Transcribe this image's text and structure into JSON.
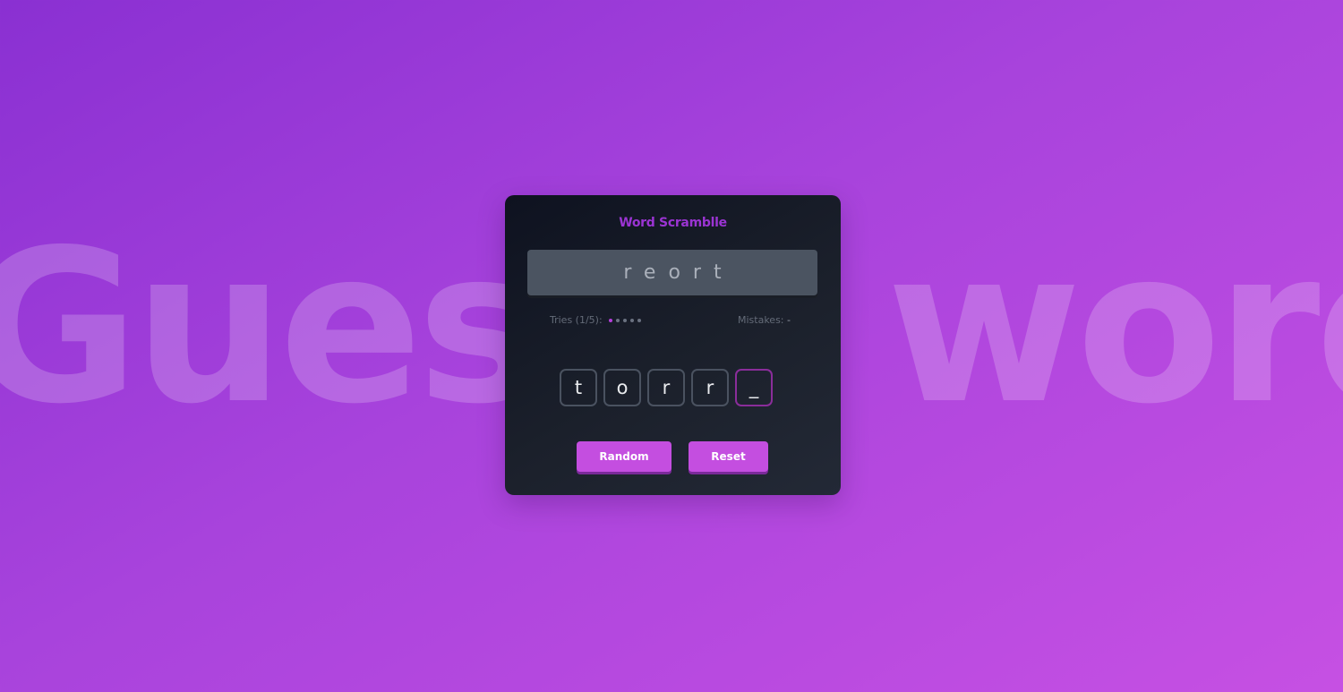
{
  "background": {
    "left_word": "Guess",
    "right_word": "word"
  },
  "card": {
    "title": "Word Scramblle",
    "scrambled_word": "reort",
    "tries_label": "Tries (1/5):",
    "tries_used": 1,
    "tries_total": 5,
    "mistakes_label": "Mistakes:",
    "mistakes_value": "-",
    "letters": [
      "t",
      "o",
      "r",
      "r",
      "_"
    ],
    "random_label": "Random",
    "reset_label": "Reset"
  },
  "colors": {
    "accent": "#c44ee0",
    "title": "#9b34d3",
    "active_dot": "#b63fdc",
    "current_letter_border": "#8a2d9a"
  }
}
